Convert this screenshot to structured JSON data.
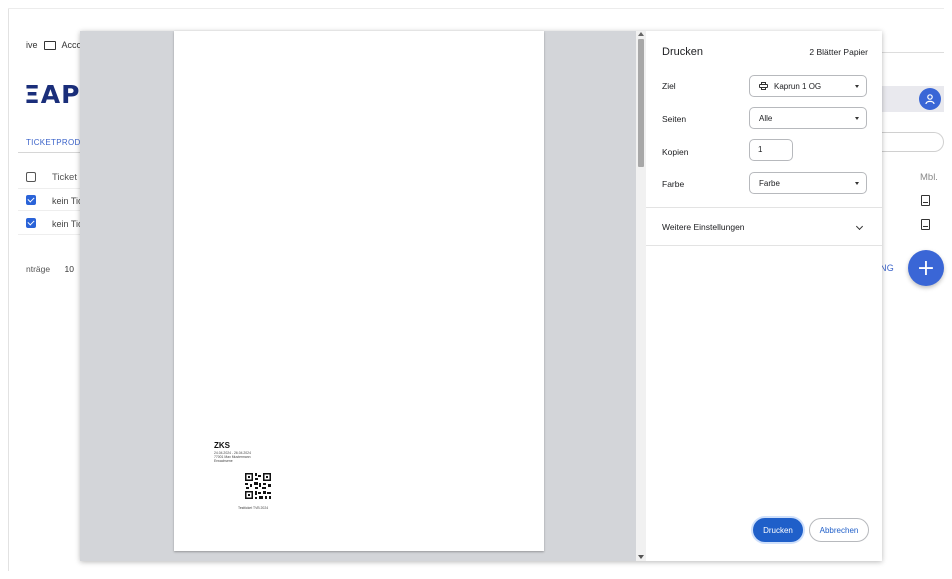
{
  "background_app": {
    "breadcrumb": {
      "prefix": "ive",
      "folder_label": "Accour"
    },
    "logo_text": "ΞAPC",
    "tab_label": "TICKETPRODU",
    "table": {
      "column_ticket": "Ticket",
      "column_mbl": "Mbl.",
      "rows": [
        {
          "ticket": "kein Tic"
        },
        {
          "ticket": "kein Tic"
        }
      ]
    },
    "entries_label": "nträge",
    "entries_count": "10",
    "right_link_text": "NG",
    "fab_symbol": "+"
  },
  "print_dialog": {
    "title": "Drucken",
    "sheets": "2 Blätter Papier",
    "destination_label": "Ziel",
    "destination_value": "Kaprun 1 OG",
    "pages_label": "Seiten",
    "pages_value": "Alle",
    "copies_label": "Kopien",
    "copies_value": "1",
    "color_label": "Farbe",
    "color_value": "Farbe",
    "more_settings_label": "Weitere Einstellungen",
    "print_button": "Drucken",
    "cancel_button": "Abbrechen"
  },
  "preview": {
    "ticket_title": "ZKS",
    "ticket_lines": [
      "24.04.2024 - 26.04.2024",
      "77001 Max Mustermann",
      "Erwachsene"
    ],
    "ticket_footer": "Testticket TVB 2024"
  },
  "colors": {
    "accent": "#1f5fc9",
    "app_blue": "#3a66d6",
    "preview_background": "#d3d5d9"
  },
  "icons": {
    "folder": "folder-icon",
    "user": "user-icon",
    "document": "document-icon",
    "printer": "printer-icon",
    "chevron": "chevron-down-icon",
    "add": "add-icon"
  }
}
